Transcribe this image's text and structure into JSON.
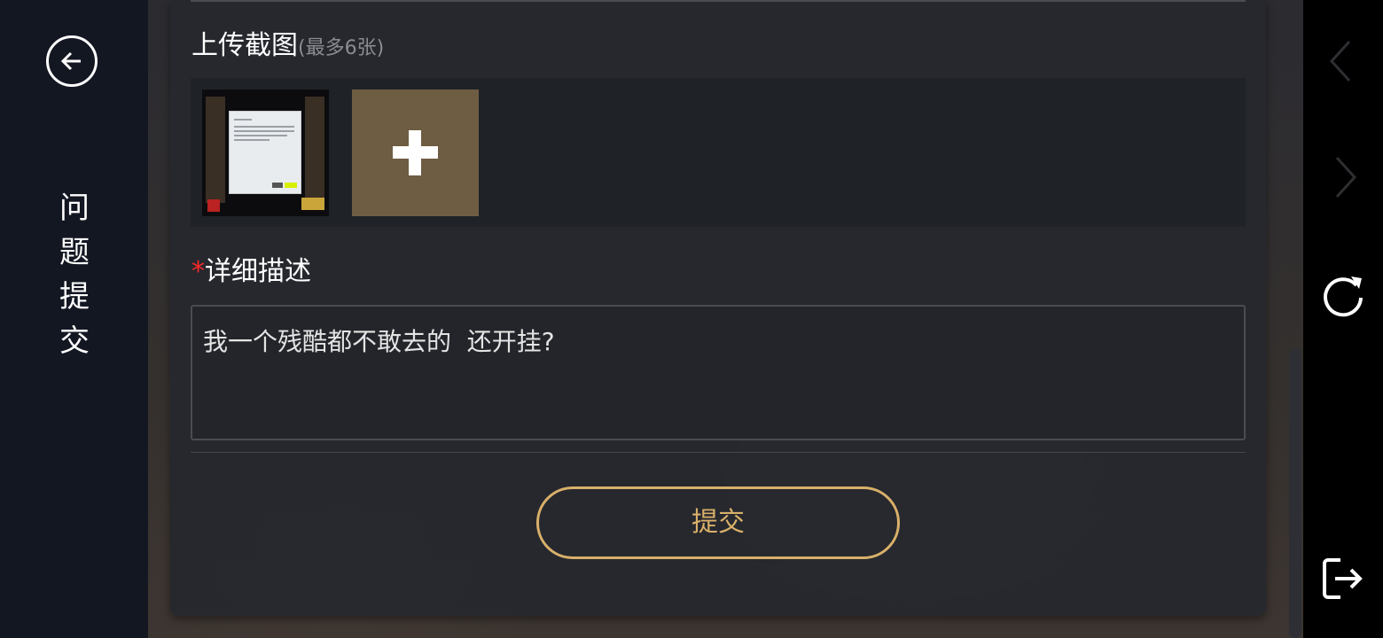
{
  "sidebar": {
    "back_icon": "arrow-left-circle-icon",
    "title_chars": [
      "问",
      "题",
      "提",
      "交"
    ]
  },
  "upload": {
    "title": "上传截图",
    "hint": "(最多6张)",
    "add_icon": "plus-icon",
    "add_color": "#6e5d43"
  },
  "description": {
    "required_mark": "*",
    "title": "详细描述",
    "value": "我一个残酷都不敢去的  还开挂?"
  },
  "submit": {
    "label": "提交",
    "accent": "#d9b06a"
  },
  "system_bar": {
    "icons": [
      "chevron-left-icon",
      "chevron-right-icon",
      "refresh-icon",
      "exit-icon"
    ]
  },
  "colors": {
    "sidebar_bg": "#131722",
    "panel_bg": "#26282e",
    "required_star": "#ff2a2a"
  }
}
